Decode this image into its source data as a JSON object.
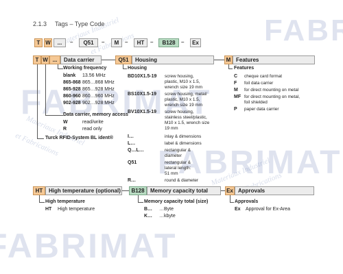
{
  "header": {
    "section_number": "2.1.3",
    "section_title": "Tags – Type Code"
  },
  "watermark": {
    "logo": "FABRIMAT",
    "line1": "Materiaux Industriel",
    "line2": "et Fabrications"
  },
  "code_row": {
    "items": [
      "T",
      "W",
      "...",
      "Q51",
      "M",
      "HT",
      "B128",
      "Ex"
    ]
  },
  "row1": {
    "t": "T",
    "w": "W",
    "dots": "...",
    "data_carrier": "Data carrier",
    "q51": "Q51",
    "housing": "Housing",
    "m": "M",
    "features": "Features"
  },
  "working_frequency": {
    "title": "Working frequency",
    "rows": [
      {
        "code": "blank",
        "desc": "13.56 MHz"
      },
      {
        "code": "865-868",
        "desc": "865…868 MHz"
      },
      {
        "code": "865-928",
        "desc": "865…928 MHz"
      },
      {
        "code": "860-960",
        "desc": "860…960 MHz"
      },
      {
        "code": "902-928",
        "desc": "902…928 MHz"
      }
    ]
  },
  "data_carrier_memory": {
    "title": "Data carrier, memory access",
    "rows": [
      {
        "code": "W",
        "desc": "read/write"
      },
      {
        "code": "R",
        "desc": "read only"
      }
    ]
  },
  "turck": {
    "title": "Turck RFID-System BL ident®"
  },
  "housing_block": {
    "title": "Housing",
    "rows": [
      {
        "code": "BD10X1.5-19",
        "desc": [
          "screw housing,",
          "plastic, M10 x 1.5,",
          "wrench size 19 mm"
        ]
      },
      {
        "code": "BS10X1.5-19",
        "desc": [
          "screw housing, metal/",
          "plastic, M10 x 1.5,",
          "wrench size 19 mm"
        ]
      },
      {
        "code": "BV10X1.5-19",
        "desc": [
          "screw housing,",
          "stainless steel/plastic,",
          "M10 x 1.5, wrench size",
          "19 mm"
        ]
      },
      {
        "code": "I…",
        "desc": [
          "inlay & dimensions"
        ]
      },
      {
        "code": "L…",
        "desc": [
          "label & dimensions"
        ]
      },
      {
        "code": "Q…L…",
        "desc": [
          "rectangular &",
          "diameter"
        ]
      },
      {
        "code": "Q51",
        "desc": [
          "rectangular &",
          "lateral length:",
          "51 mm"
        ]
      },
      {
        "code": "R…",
        "desc": [
          "round & diameter"
        ]
      }
    ]
  },
  "features_block": {
    "title": "Features",
    "rows": [
      {
        "code": "C",
        "desc": [
          "cheque card format"
        ]
      },
      {
        "code": "F",
        "desc": [
          "foil data carrier"
        ]
      },
      {
        "code": "M",
        "desc": [
          "for direct mounting on metal"
        ]
      },
      {
        "code": "MF",
        "desc": [
          "for direct mounting on metal,",
          "foil shielded"
        ]
      },
      {
        "code": "P",
        "desc": [
          "paper data carrier"
        ]
      }
    ]
  },
  "row2": {
    "ht": "HT",
    "high_temp": "High temperature (optional)",
    "b128": "B128",
    "memory": "Memory capacity total",
    "ex": "Ex",
    "approvals": "Approvals"
  },
  "ht_block": {
    "title": "High temperature",
    "rows": [
      {
        "code": "HT",
        "desc": "High temperature"
      }
    ]
  },
  "memory_block": {
    "title": "Memory capacity total (size)",
    "rows": [
      {
        "code": "B…",
        "desc": "…Byte"
      },
      {
        "code": "K…",
        "desc": "…kbyte"
      }
    ]
  },
  "approvals_block": {
    "title": "Approvals",
    "rows": [
      {
        "code": "Ex",
        "desc": "Approval for Ex-Area"
      }
    ]
  }
}
